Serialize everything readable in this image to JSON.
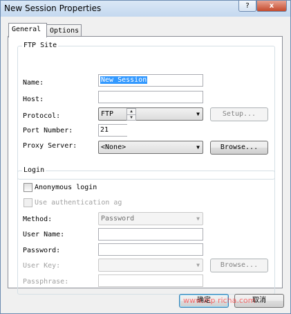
{
  "window": {
    "title": "New Session Properties",
    "help_label": "?",
    "close_label": "x"
  },
  "tabs": [
    {
      "label": "General"
    },
    {
      "label": "Options"
    }
  ],
  "ftp_site": {
    "legend": "FTP Site",
    "name_label": "Name:",
    "name_value": "New Session",
    "host_label": "Host:",
    "host_value": "",
    "protocol_label": "Protocol:",
    "protocol_value": "FTP",
    "setup_label": "Setup...",
    "port_label": "Port Number:",
    "port_value": "21",
    "proxy_label": "Proxy Server:",
    "proxy_value": "<None>",
    "browse_label": "Browse..."
  },
  "login": {
    "legend": "Login",
    "anonymous_label": "Anonymous login",
    "anonymous_checked": false,
    "auth_agent_label": "Use authentication ag",
    "auth_agent_checked": false,
    "method_label": "Method:",
    "method_value": "Password",
    "username_label": "User Name:",
    "username_value": "",
    "password_label": "Password:",
    "password_value": "",
    "userkey_label": "User Key:",
    "userkey_value": "",
    "browse_label": "Browse...",
    "passphrase_label": "Passphrase:",
    "passphrase_value": ""
  },
  "footer": {
    "ok_label": "确定",
    "cancel_label": "取消"
  },
  "watermark": {
    "text": "www.inp richa.com"
  }
}
